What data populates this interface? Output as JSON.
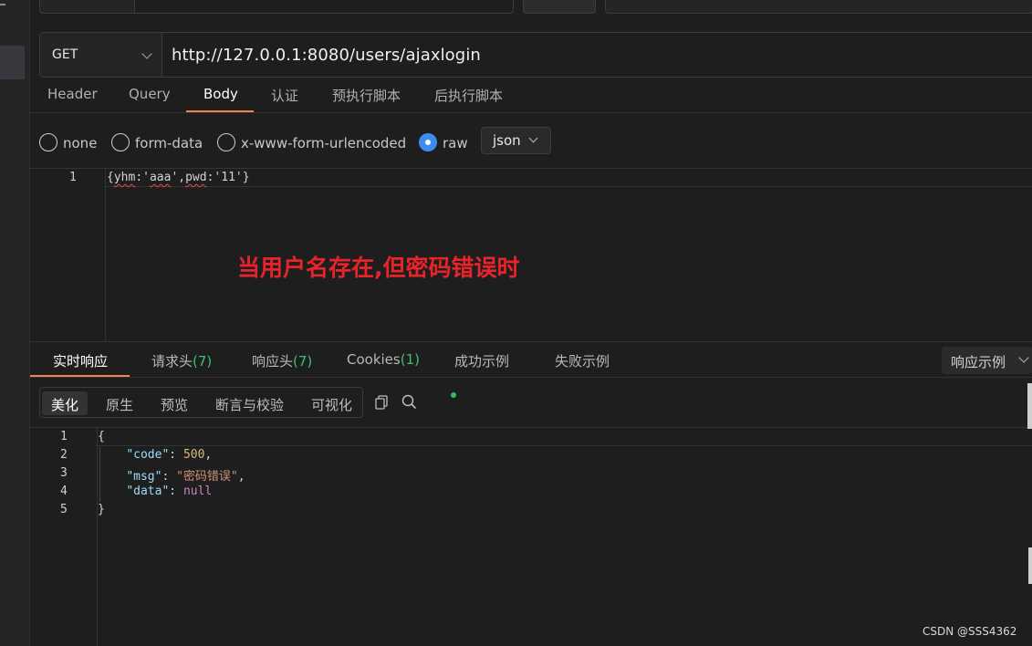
{
  "request": {
    "method": "GET",
    "url": "http://127.0.0.1:8080/users/ajaxlogin"
  },
  "request_tabs": [
    "Header",
    "Query",
    "Body",
    "认证",
    "预执行脚本",
    "后执行脚本"
  ],
  "active_request_tab": "Body",
  "body_types": [
    "none",
    "form-data",
    "x-www-form-urlencoded",
    "raw"
  ],
  "selected_body_type": "raw",
  "body_format": "json",
  "request_body": {
    "line_number": "1",
    "text_prefix": "{",
    "text_yhm": "yhm",
    "text_mid1": ":'",
    "text_aaa": "aaa",
    "text_mid2": "',",
    "text_pwd": "pwd",
    "text_suffix": ":'11'}"
  },
  "annotation": "当用户名存在,但密码错误时",
  "response_tabs": {
    "realtime": "实时响应",
    "req_headers": "请求头",
    "req_headers_count": "(7)",
    "resp_headers": "响应头",
    "resp_headers_count": "(7)",
    "cookies": "Cookies",
    "cookies_count": "(1)",
    "success_example": "成功示例",
    "fail_example": "失败示例"
  },
  "response_example_select": "响应示例",
  "view_modes": [
    "美化",
    "原生",
    "预览",
    "断言与校验",
    "可视化"
  ],
  "active_view_mode": "美化",
  "icons": {
    "copy": "copy-icon",
    "search": "search-icon"
  },
  "response_json": {
    "lines": [
      "1",
      "2",
      "3",
      "4",
      "5"
    ],
    "open_brace": "{",
    "code_key": "\"code\"",
    "code_value": "500",
    "msg_key": "\"msg\"",
    "msg_value": "\"密码错误\"",
    "data_key": "\"data\"",
    "data_value": "null",
    "close_brace": "}"
  },
  "watermark": "CSDN @SSS4362",
  "colors": {
    "accent": "#f2824e",
    "radio_checked": "#3b8ef0",
    "count_green": "#3fbf6f",
    "annotation_red": "#e8232a"
  }
}
